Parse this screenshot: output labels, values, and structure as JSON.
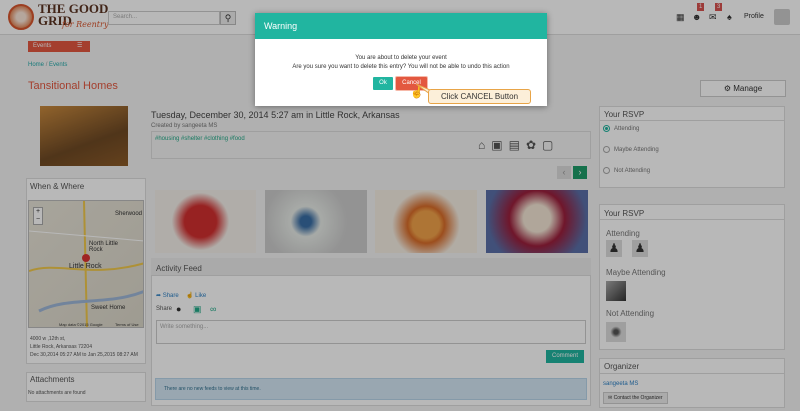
{
  "header": {
    "logo_text_line1": "THE GOOD",
    "logo_text_line2": "GRID",
    "logo_tagline": "for Reentry",
    "search_placeholder": "Search...",
    "badge_people": "1",
    "badge_mail": "3",
    "profile_label": "Profile"
  },
  "nav": {
    "events_button": "Events",
    "breadcrumb_home": "Home",
    "breadcrumb_sep": "/",
    "breadcrumb_events": "Events"
  },
  "page": {
    "title": "Tansitional Homes",
    "manage_button": "Manage"
  },
  "event": {
    "title": "Tuesday, December 30, 2014 5:27 am in Little Rock, Arkansas",
    "created_by": "Created by sangeeta MS",
    "tags": "#housing #shelter #clothing #food"
  },
  "when_where": {
    "heading": "When & Where",
    "address1": "4000 w ,12th st,",
    "address2": "Little Rock, Arkansas 72204",
    "dates": "Dec 30,2014 05:27 AM to Jan 25,2015 08:27 AM",
    "map_labels": [
      "Sherwood",
      "North Little Rock",
      "Little Rock",
      "Sweet Home"
    ],
    "map_attribution": "Map data ©2015 Google",
    "map_terms": "Terms of Use"
  },
  "attachments": {
    "heading": "Attachments",
    "empty": "No attachments are found"
  },
  "activity": {
    "heading": "Activity Feed",
    "share_link": "Share",
    "like_link": "Like",
    "share_label": "Share",
    "textarea_placeholder": "Write something...",
    "comment_button": "Comment",
    "no_feeds": "There are no new feeds to view at this time."
  },
  "rsvp1": {
    "heading": "Your RSVP",
    "options": [
      "Attending",
      "Maybe Attending",
      "Not Attending"
    ]
  },
  "rsvp2": {
    "heading": "Your RSVP",
    "attending": "Attending",
    "maybe": "Maybe Attending",
    "not": "Not Attending"
  },
  "organizer": {
    "heading": "Organizer",
    "name": "sangeeta MS",
    "contact_button": "Contact the Organizer"
  },
  "modal": {
    "title": "Warning",
    "line1": "You are about to delete your event",
    "line2": "Are you sure you want to delete this entry? You will not be able to undo this action",
    "ok_button": "Ok",
    "cancel_button": "Cancel"
  },
  "callout": "Click CANCEL Button",
  "colors": {
    "accent_teal": "#21b5a0",
    "accent_red": "#e35840"
  }
}
